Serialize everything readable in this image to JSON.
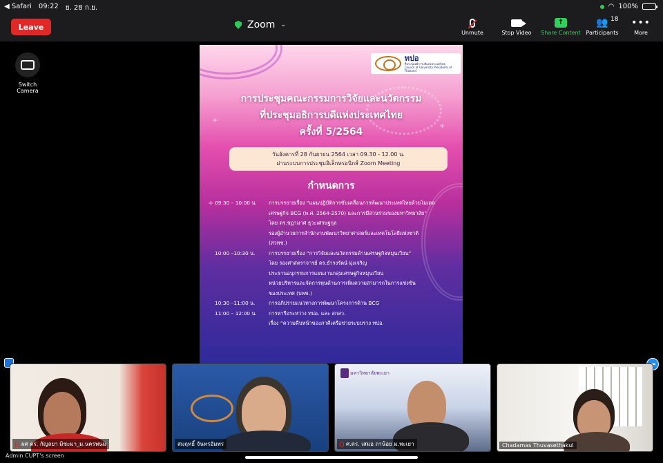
{
  "status_bar": {
    "back_app": "◀ Safari",
    "time": "09:22",
    "date": "ย. 28 ก.ย.",
    "battery": "100%",
    "battery_level": 1.0
  },
  "toolbar": {
    "leave_label": "Leave",
    "meeting_title": "Zoom",
    "unmute_label": "Unmute",
    "stop_video_label": "Stop Video",
    "share_label": "Share Content",
    "participants_label": "Participants",
    "participants_count": "18",
    "more_label": "More",
    "accent_green": "#2fd05b",
    "leave_color": "#e02828"
  },
  "switch_camera_label": "Switch Camera",
  "slide": {
    "logo_text": "ทปอ",
    "logo_sub": "ที่ประชุมอธิการบดีแห่งประเทศไทย",
    "logo_sub_en": "Council of University Presidents of Thailand",
    "title_lines": [
      "การประชุมคณะกรรมการวิจัยและนวัตกรรม",
      "ที่ประชุมอธิการบดีแห่งประเทศไทย",
      "ครั้งที่ 5/2564"
    ],
    "date_line": "วันอังคารที่ 28 กันยายน 2564 เวลา 09.30 - 12.00 น.",
    "venue_line": "ผ่านระบบการประชุมอิเล็กทรอนิกส์ Zoom Meeting",
    "agenda_heading": "กำหนดการ",
    "agenda": [
      {
        "time": "09:30 – 10:00 น.",
        "desc": "การบรรยายเรื่อง “แผนปฏิบัติการขับเคลื่อนการพัฒนาประเทศไทยด้วยโมเดล"
      },
      {
        "time": "",
        "desc": "เศรษฐกิจ BCG (พ.ศ. 2564-2570) และการมีส่วนร่วมของมหาวิทยาลัย”"
      },
      {
        "time": "",
        "desc": "โดย ดร.ชฎามาศ ธุวะเศรษฐกุล"
      },
      {
        "time": "",
        "desc": "รองผู้อำนวยการสำนักงานพัฒนาวิทยาศาสตร์และเทคโนโลยีแห่งชาติ"
      },
      {
        "time": "",
        "desc": "(สวทช.)"
      },
      {
        "time": "10:00 –10:30 น.",
        "desc": "การบรรยายเรื่อง “การวิจัยและนวัตกรรมด้านเศรษฐกิจหมุนเวียน”"
      },
      {
        "time": "",
        "desc": "โดย รองศาสตราจารย์ ดร.ธำรงรัตน์ มุ่งเจริญ"
      },
      {
        "time": "",
        "desc": "ประธานอนุกรรมการแผนงานกลุ่มเศรษฐกิจหมุนเวียน"
      },
      {
        "time": "",
        "desc": "หน่วยบริหารและจัดการทุนด้านการเพิ่มความสามารถในการแข่งขัน"
      },
      {
        "time": "",
        "desc": "ของประเทศ (บพข.)"
      },
      {
        "time": "10:30 –11:00 น.",
        "desc": "การอภิปรายแนวทางการพัฒนาโครงการด้าน BCG"
      },
      {
        "time": "11:00 – 12:00 น.",
        "desc": "การหารือระหว่าง ทปอ. และ สกสว."
      },
      {
        "time": "",
        "desc": "เรื่อง “ความคืบหน้าของภาคีเครือข่ายระบบราง ทปอ."
      }
    ]
  },
  "participants": [
    {
      "name": "ผศ ดร. กัญลยา มิซะมา_ม.นครพนม",
      "muted": true
    },
    {
      "name": "สมฤทธิ์ จันทรอัมพร",
      "muted": false
    },
    {
      "name": "ศ.ดร. เสมอ ถาน้อย ม.พะเยา",
      "muted": true
    },
    {
      "name": "Chadamas Thuvasethakul",
      "muted": false
    }
  ],
  "tile3_logo_text": "มหาวิทยาลัยพะเยา",
  "screen_label": "Admin CUPT's screen"
}
